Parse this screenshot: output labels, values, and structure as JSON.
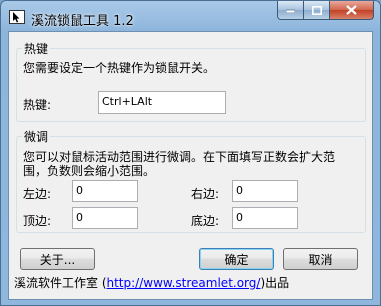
{
  "window": {
    "title": "溪流锁鼠工具 1.2",
    "icon": "cursor-lock-icon"
  },
  "hotkey_group": {
    "title": "热键",
    "description": "您需要设定一个热键作为锁鼠开关。",
    "label": "热键:",
    "value": "Ctrl+LAlt"
  },
  "tweak_group": {
    "title": "微调",
    "description_line1": "您可以对鼠标活动范围进行微调。在下面填写正数会扩大范",
    "description_line2": "围，负数则会缩小范围。",
    "left_label": "左边:",
    "left_value": "0",
    "right_label": "右边:",
    "right_value": "0",
    "top_label": "顶边:",
    "top_value": "0",
    "bottom_label": "底边:",
    "bottom_value": "0"
  },
  "buttons": {
    "about": "关于...",
    "ok": "确定",
    "cancel": "取消"
  },
  "footer": {
    "prefix": "溪流软件工作室 (",
    "link": "http://www.streamlet.org/",
    "suffix": ")出品"
  }
}
